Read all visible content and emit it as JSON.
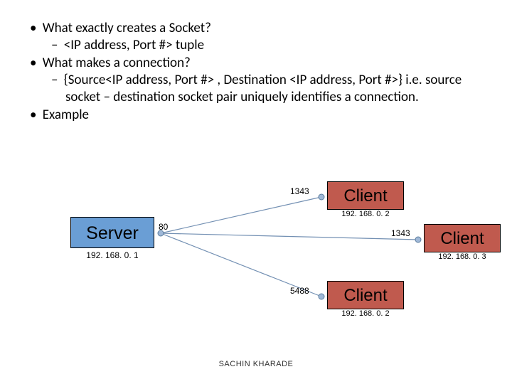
{
  "bullets": {
    "q1": "What exactly creates a Socket?",
    "a1": "<IP address, Port #> tuple",
    "q2": "What makes a connection?",
    "a2": "{Source<IP address, Port #> , Destination <IP address, Port #>} i.e. source socket – destination socket pair uniquely identifies a connection.",
    "q3": "Example"
  },
  "diagram": {
    "server": {
      "label": "Server",
      "ip": "192. 168. 0. 1",
      "port": "80"
    },
    "client1": {
      "label": "Client",
      "ip": "192. 168. 0. 2",
      "port": "1343"
    },
    "client2": {
      "label": "Client",
      "ip": "192. 168. 0. 3",
      "port": "1343"
    },
    "client3": {
      "label": "Client",
      "ip": "192. 168. 0. 2",
      "port": "5488"
    }
  },
  "footer": "SACHIN KHARADE"
}
